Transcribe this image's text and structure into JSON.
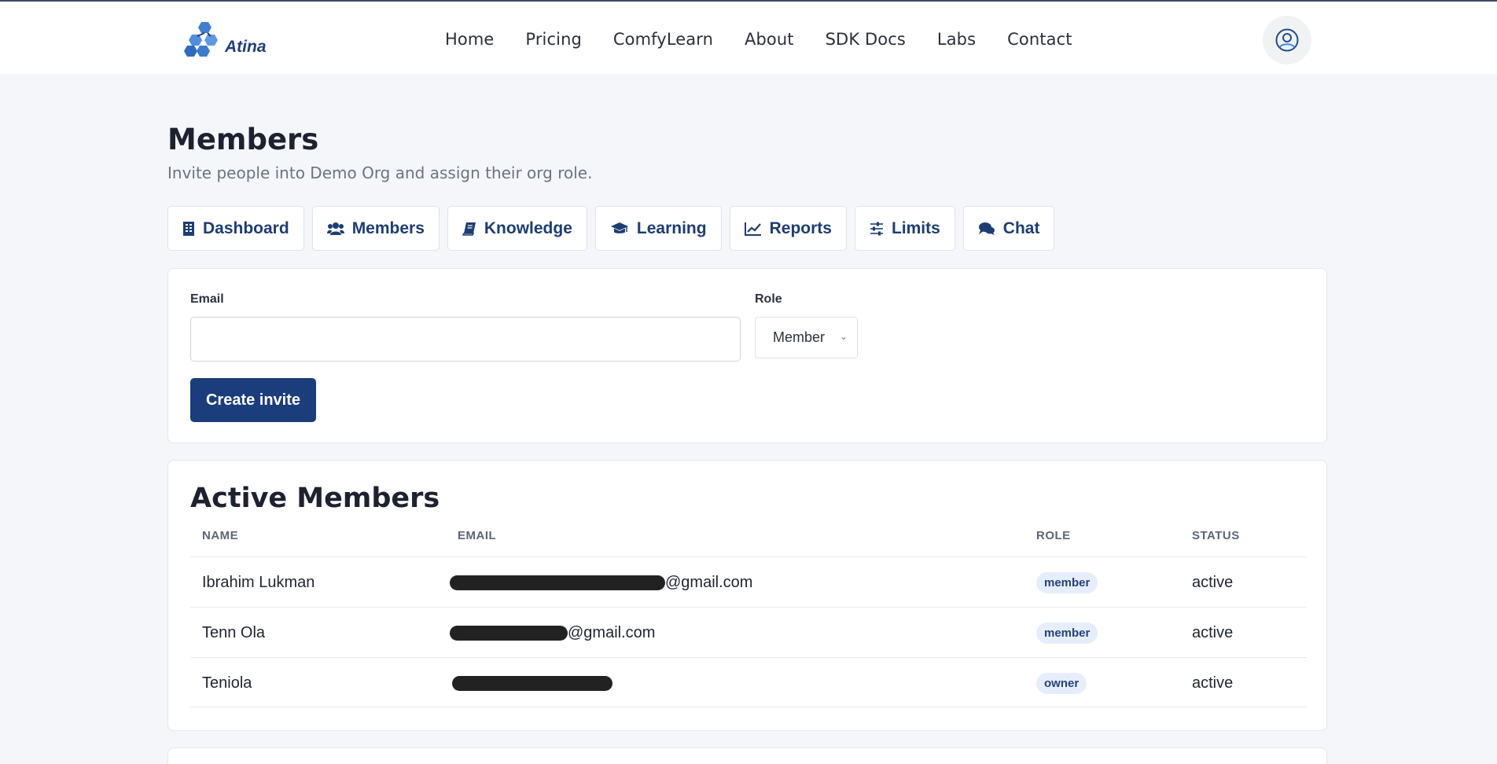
{
  "nav": {
    "logo_text": "Atina",
    "links": [
      "Home",
      "Pricing",
      "ComfyLearn",
      "About",
      "SDK Docs",
      "Labs",
      "Contact"
    ]
  },
  "page": {
    "title": "Members",
    "subtitle": "Invite people into Demo Org and assign their org role."
  },
  "tabs": [
    {
      "label": "Dashboard",
      "icon": "building-icon"
    },
    {
      "label": "Members",
      "icon": "users-icon"
    },
    {
      "label": "Knowledge",
      "icon": "book-icon"
    },
    {
      "label": "Learning",
      "icon": "graduation-cap-icon"
    },
    {
      "label": "Reports",
      "icon": "line-chart-icon"
    },
    {
      "label": "Limits",
      "icon": "sliders-icon"
    },
    {
      "label": "Chat",
      "icon": "comments-icon"
    }
  ],
  "invite": {
    "email_label": "Email",
    "email_value": "",
    "role_label": "Role",
    "role_value": "Member",
    "create_label": "Create invite"
  },
  "members": {
    "title": "Active Members",
    "columns": [
      "NAME",
      "EMAIL",
      "ROLE",
      "STATUS"
    ],
    "rows": [
      {
        "name": "Ibrahim Lukman",
        "email_suffix": "@gmail.com",
        "role": "member",
        "status": "active"
      },
      {
        "name": "Tenn Ola",
        "email_suffix": "@gmail.com",
        "role": "member",
        "status": "active"
      },
      {
        "name": "Teniola",
        "email_suffix": "",
        "role": "owner",
        "status": "active"
      }
    ]
  },
  "colors": {
    "primary": "#1c3d7c",
    "badge_bg": "#e7eefb",
    "page_bg": "#f4f6f9"
  }
}
